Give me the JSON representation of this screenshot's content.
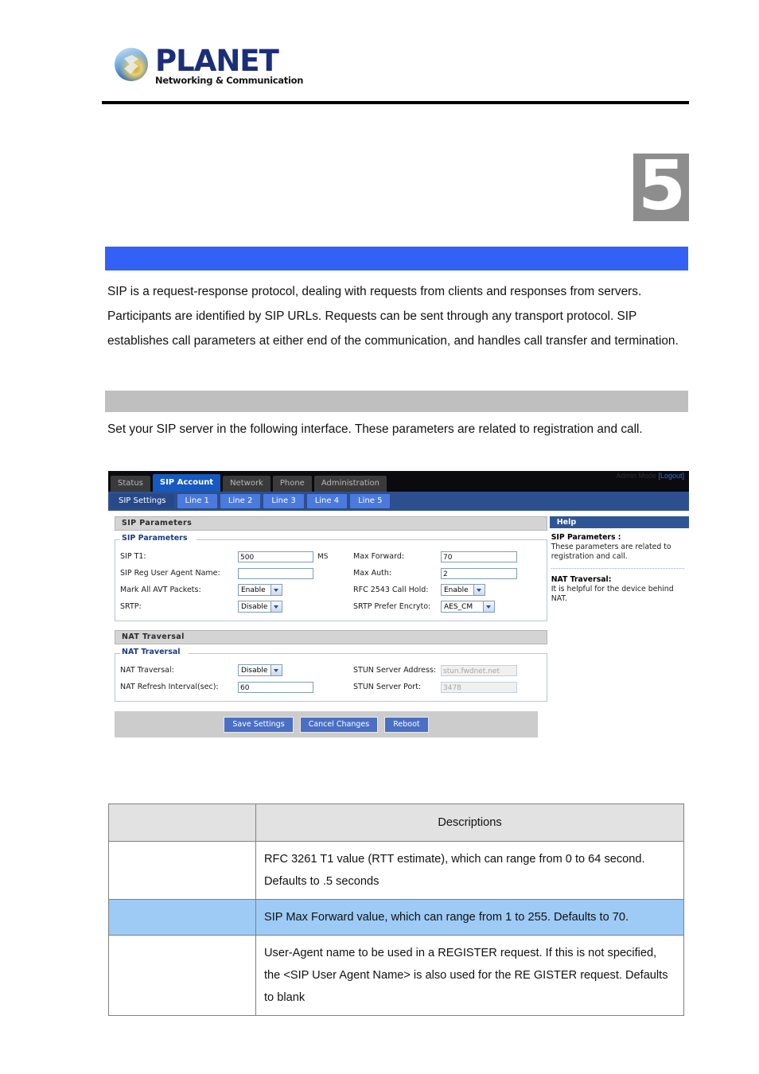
{
  "header": {
    "logo_word": "PLANET",
    "logo_tagline": "Networking & Communication",
    "chapter_number": "5"
  },
  "sections": {
    "blue_bar_title": "",
    "gray_bar_title": "",
    "intro_paragraph": "SIP is a request-response protocol, dealing with requests from clients and responses from servers. Participants are identified by SIP URLs. Requests can be sent through any transport protocol. SIP establishes call parameters at either end of the communication, and handles call transfer and termination.",
    "interface_paragraph": "Set your SIP server in the following interface. These parameters are related to registration and call."
  },
  "webui": {
    "admin_mode_label": "Admin Mode",
    "logout_label": "[Logout]",
    "main_tabs": [
      {
        "label": "Status",
        "active": false
      },
      {
        "label": "SIP Account",
        "active": true
      },
      {
        "label": "Network",
        "active": false
      },
      {
        "label": "Phone",
        "active": false
      },
      {
        "label": "Administration",
        "active": false
      }
    ],
    "sub_tabs": [
      {
        "label": "SIP Settings",
        "active": true
      },
      {
        "label": "Line 1",
        "active": false
      },
      {
        "label": "Line 2",
        "active": false
      },
      {
        "label": "Line 3",
        "active": false
      },
      {
        "label": "Line 4",
        "active": false
      },
      {
        "label": "Line 5",
        "active": false
      }
    ],
    "sip_panel": {
      "panel_title": "SIP Parameters",
      "legend": "SIP Parameters",
      "fields": {
        "sip_t1_label": "SIP T1:",
        "sip_t1_value": "500",
        "sip_t1_unit": "MS",
        "max_forward_label": "Max Forward:",
        "max_forward_value": "70",
        "sip_reg_ua_label": "SIP Reg User Agent Name:",
        "sip_reg_ua_value": "",
        "max_auth_label": "Max Auth:",
        "max_auth_value": "2",
        "mark_avt_label": "Mark All AVT Packets:",
        "mark_avt_value": "Enable",
        "rfc2543_label": "RFC 2543 Call Hold:",
        "rfc2543_value": "Enable",
        "srtp_label": "SRTP:",
        "srtp_value": "Disable",
        "srtp_encrypt_label": "SRTP Prefer Encryto:",
        "srtp_encrypt_value": "AES_CM"
      }
    },
    "nat_panel": {
      "panel_title": "NAT Traversal",
      "legend": "NAT Traversal",
      "fields": {
        "nat_traversal_label": "NAT Traversal:",
        "nat_traversal_value": "Disable",
        "stun_addr_label": "STUN Server Address:",
        "stun_addr_value": "stun.fwdnet.net",
        "nat_refresh_label": "NAT Refresh Interval(sec):",
        "nat_refresh_value": "60",
        "stun_port_label": "STUN Server Port:",
        "stun_port_value": "3478"
      }
    },
    "help": {
      "title": "Help",
      "entries": [
        {
          "term": "SIP Parameters :",
          "text": "These parameters are related to registration and call."
        },
        {
          "term": "NAT Traversal:",
          "text": "It is helpful for the device behind NAT."
        }
      ]
    },
    "buttons": {
      "save": "Save Settings",
      "cancel": "Cancel Changes",
      "reboot": "Reboot"
    }
  },
  "descriptions_table": {
    "headers": [
      "",
      "Descriptions"
    ],
    "rows": [
      {
        "name": "",
        "description": "RFC 3261 T1 value (RTT estimate), which can range from 0 to 64 second. Defaults to .5 seconds",
        "highlight": false
      },
      {
        "name": "",
        "description": "SIP Max Forward value, which can range from 1 to 255. Defaults to 70.",
        "highlight": true
      },
      {
        "name": "",
        "description": "User-Agent name to be used in a REGISTER request. If this is not specified, the <SIP User Agent Name> is also used for the RE GISTER request. Defaults to blank",
        "highlight": false
      }
    ]
  },
  "colors": {
    "blue_bar": "#3361f5",
    "gray_bar": "#bfbfbf",
    "chapter_badge": "#8d8d8d",
    "row_highlight": "#9dcbf5",
    "active_tab": "#1659c0"
  }
}
